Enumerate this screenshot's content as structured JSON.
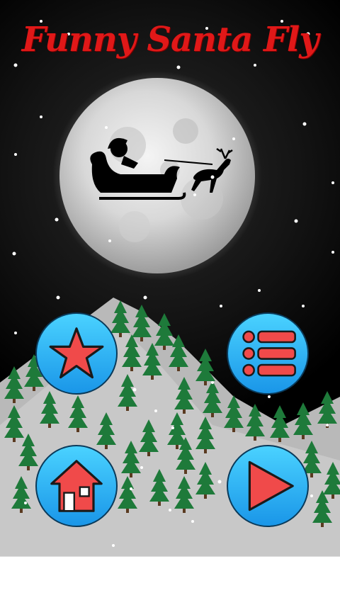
{
  "app": {
    "title": "Funny Santa Fly"
  },
  "colors": {
    "title": "#e01818",
    "button_gradient_top": "#4ad2ff",
    "button_gradient_bottom": "#1a96e8",
    "icon_fill": "#f04a4a",
    "tree": "#1e7a3a",
    "hill": "#b9b9b9"
  },
  "buttons": {
    "rate": {
      "icon": "star-icon"
    },
    "menu": {
      "icon": "list-icon"
    },
    "home": {
      "icon": "house-icon"
    },
    "play": {
      "icon": "play-icon"
    }
  }
}
